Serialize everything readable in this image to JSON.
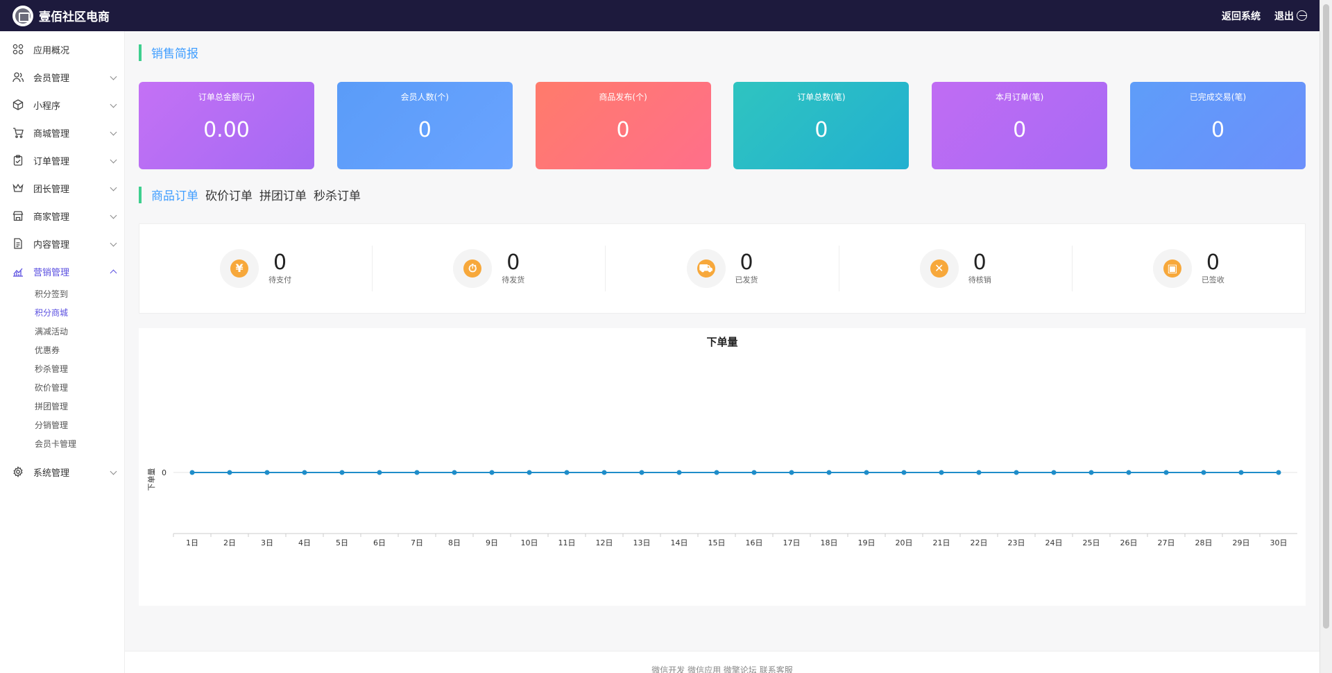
{
  "header": {
    "title": "壹佰社区电商",
    "back_label": "返回系统",
    "logout_label": "退出"
  },
  "sidebar": {
    "items": [
      {
        "label": "应用概况",
        "icon": "apps-icon",
        "has_children": false
      },
      {
        "label": "会员管理",
        "icon": "users-icon",
        "has_children": true
      },
      {
        "label": "小程序",
        "icon": "cube-icon",
        "has_children": true
      },
      {
        "label": "商城管理",
        "icon": "cart-icon",
        "has_children": true
      },
      {
        "label": "订单管理",
        "icon": "clipboard-icon",
        "has_children": true
      },
      {
        "label": "团长管理",
        "icon": "crown-icon",
        "has_children": true
      },
      {
        "label": "商家管理",
        "icon": "store-icon",
        "has_children": true
      },
      {
        "label": "内容管理",
        "icon": "document-icon",
        "has_children": true
      },
      {
        "label": "营销管理",
        "icon": "chart-line-icon",
        "has_children": true,
        "expanded": true
      }
    ],
    "sub_items": [
      "积分签到",
      "积分商城",
      "满减活动",
      "优惠券",
      "秒杀管理",
      "砍价管理",
      "拼团管理",
      "分销管理",
      "会员卡管理"
    ],
    "active_sub": 1,
    "system_item": {
      "label": "系统管理",
      "icon": "gear-icon"
    }
  },
  "sales": {
    "title": "销售简报",
    "cards": [
      {
        "label": "订单总金额(元)",
        "value": "0.00",
        "gradient": [
          "#c471f5",
          "#a46af3"
        ]
      },
      {
        "label": "会员人数(个)",
        "value": "0",
        "gradient": [
          "#5a9cf8",
          "#6aa3ff"
        ]
      },
      {
        "label": "商品发布(个)",
        "value": "0",
        "gradient": [
          "#ff7b6b",
          "#ff6f8a"
        ]
      },
      {
        "label": "订单总数(笔)",
        "value": "0",
        "gradient": [
          "#2fc4c0",
          "#22b0d0"
        ]
      },
      {
        "label": "本月订单(笔)",
        "value": "0",
        "gradient": [
          "#c06cf3",
          "#a86af4"
        ]
      },
      {
        "label": "已完成交易(笔)",
        "value": "0",
        "gradient": [
          "#5e9df9",
          "#6c8ffb"
        ]
      }
    ]
  },
  "order_tabs": {
    "tabs": [
      "商品订单",
      "砍价订单",
      "拼团订单",
      "秒杀订单"
    ],
    "active": 0
  },
  "order_stats": [
    {
      "label": "待支付",
      "value": "0",
      "icon": "yen-icon",
      "glyph": "¥"
    },
    {
      "label": "待发货",
      "value": "0",
      "icon": "delivery-clock-icon",
      "glyph": "⏱"
    },
    {
      "label": "已发货",
      "value": "0",
      "icon": "truck-icon",
      "glyph": "⛟"
    },
    {
      "label": "待核销",
      "value": "0",
      "icon": "verify-icon",
      "glyph": "✕"
    },
    {
      "label": "已签收",
      "value": "0",
      "icon": "package-icon",
      "glyph": "▣"
    }
  ],
  "chart_data": {
    "type": "line",
    "title": "下单量",
    "ylabel": "下单量",
    "xlabel": "",
    "x": [
      "1日",
      "2日",
      "3日",
      "4日",
      "5日",
      "6日",
      "7日",
      "8日",
      "9日",
      "10日",
      "11日",
      "12日",
      "13日",
      "14日",
      "15日",
      "16日",
      "17日",
      "18日",
      "19日",
      "20日",
      "21日",
      "22日",
      "23日",
      "24日",
      "25日",
      "26日",
      "27日",
      "28日",
      "29日",
      "30日"
    ],
    "series": [
      {
        "values": [
          0,
          0,
          0,
          0,
          0,
          0,
          0,
          0,
          0,
          0,
          0,
          0,
          0,
          0,
          0,
          0,
          0,
          0,
          0,
          0,
          0,
          0,
          0,
          0,
          0,
          0,
          0,
          0,
          0,
          0
        ]
      }
    ],
    "yticks": [
      "0"
    ],
    "color": "#1f8dc9"
  },
  "footer": {
    "text": "微信开发 微信应用 微擎论坛 联系客服"
  }
}
